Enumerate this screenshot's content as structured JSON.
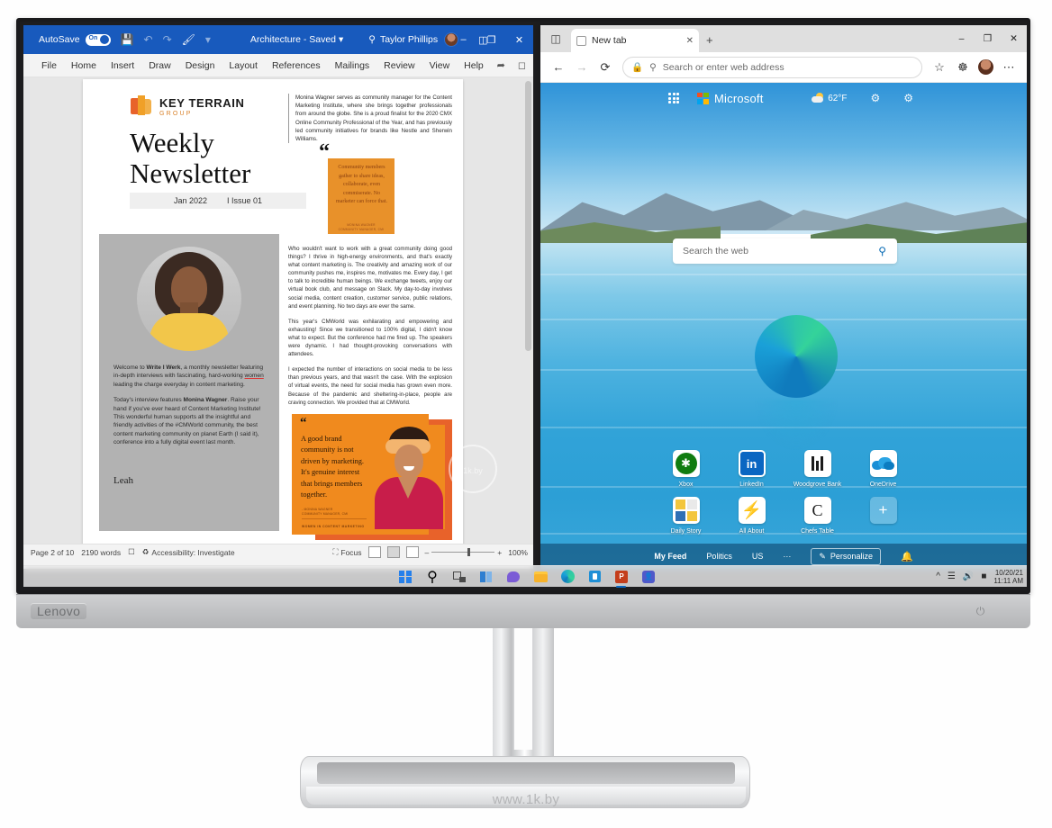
{
  "monitor": {
    "brand": "Lenovo",
    "power_icon": "power-icon",
    "watermark": "www.1k.by"
  },
  "word": {
    "titlebar": {
      "autosave_label": "AutoSave",
      "autosave_state": "On",
      "save_icon": "save-icon",
      "undo_icon": "undo-icon",
      "redo_icon": "redo-icon",
      "draw_icon": "draw-touch-icon",
      "customize_icon": "chevron-down-icon",
      "document_title": "Architecture - Saved",
      "title_dropdown": "▾",
      "search_icon": "search-icon",
      "user_name": "Taylor Phillips",
      "avatar": "user-avatar",
      "ribbon_display_icon": "ribbon-display-options-icon",
      "minimize": "–",
      "maximize": "❐",
      "close": "✕"
    },
    "ribbon_tabs": [
      "File",
      "Home",
      "Insert",
      "Draw",
      "Design",
      "Layout",
      "References",
      "Mailings",
      "Review",
      "View",
      "Help"
    ],
    "ribbon_right": [
      "share-icon",
      "comments-icon"
    ],
    "status": {
      "page_info": "Page 2 of 10",
      "word_count": "2190 words",
      "proofing_icon": "proofing-icon",
      "accessibility_icon": "accessibility-icon",
      "accessibility": "Accessibility: Investigate",
      "focus_icon": "focus-icon",
      "focus": "Focus",
      "view_read_icon": "read-mode-icon",
      "view_print_icon": "print-layout-icon",
      "view_web_icon": "web-layout-icon",
      "zoom_out": "–",
      "zoom_in": "+",
      "zoom_level": "100%"
    },
    "document": {
      "brand_name": "KEY TERRAIN",
      "brand_sub": "GROUP",
      "brand_mark_icon": "key-terrain-logo-icon",
      "title_line1": "Weekly",
      "title_line2": "Newsletter",
      "meta_date": "Jan 2022",
      "meta_issue": "I  Issue 01",
      "portrait_alt": "portrait-monina-wagner",
      "intro_paragraph": "Monina Wagner serves as community manager for the Content Marketing Institute, where she brings together professionals from around the globe. She is a proud finalist for the 2020 CMX Online Community Professional of the Year, and has previously led community initiatives for brands like Nestle and Sherwin Williams.",
      "small_quote": {
        "mark": "“",
        "text": "Community members gather to share ideas, collaborate, even commiserate. No marketer can force that.",
        "attribution_line1": "MONINA WAGNER",
        "attribution_line2": "COMMUNITY MANAGER, CMI"
      },
      "left_col": {
        "p1_a": "Welcome to ",
        "p1_b": "Write I Werk",
        "p1_c": ", a monthly newsletter featuring in-depth interviews with fascinating, hard-working ",
        "p1_d": "women",
        "p1_e": " leading the charge everyday in content marketing.",
        "p2_a": "Today's interview features ",
        "p2_b": "Monina Wagner",
        "p2_c": ". Raise your hand if you've ever heard of Content Marketing Institute! This wonderful human supports all the insightful and friendly activities of the #CMWorld community, the best content marketing community on planet Earth (I said it), conference into a fully digital event last month.",
        "signature": "Leah"
      },
      "body_paragraphs": [
        "Who wouldn't want to work with a great community doing good things? I thrive in high-energy environments, and that's exactly what content marketing is. The creativity and amazing work of our community pushes me, inspires me, motivates me. Every day, I get to talk to incredible human beings. We exchange tweets, enjoy our virtual book club, and message on Slack. My day-to-day involves social media, content creation, customer service, public relations, and event planning. No two days are ever the same.",
        "This year's CMWorld was exhilarating and empowering and exhausting! Since we transitioned to 100% digital, I didn't know what to expect. But the conference had me fired up. The speakers were dynamic. I had thought-provoking conversations with attendees.",
        "I expected the number of interactions on social media to be less than previous years, and that wasn't the case. With the explosion of virtual events, the need for social media has grown even more. Because of the pandemic and sheltering-in-place, people are craving connection. We provided that at CMWorld."
      ],
      "big_quote": {
        "mark": "“",
        "text": "A good brand community is not driven by marketing. It's genuine interest that brings members together.",
        "attribution_line1": "- MONINA WAGNER",
        "attribution_line2": "COMMUNITY MANAGER, CMI",
        "footer": "WOMEN IN CONTENT MARKETING",
        "photo_alt": "portrait-quote-person"
      },
      "watermark": "1k.by"
    }
  },
  "edge": {
    "tab_profile_icon": "tab-actions-icon",
    "tab": {
      "favicon": "tab-favicon",
      "title": "New tab",
      "close": "✕"
    },
    "new_tab_btn": "+",
    "window": {
      "minimize": "–",
      "maximize": "❐",
      "close": "✕"
    },
    "toolbar": {
      "back": "back-arrow-icon",
      "forward": "forward-arrow-icon",
      "refresh": "refresh-icon",
      "lock_icon": "site-info-icon",
      "search_icon": "search-icon",
      "address_placeholder": "Search or enter web address",
      "favorite_icon": "add-favorite-icon",
      "collections_icon": "collections-icon",
      "profile_icon": "profile-avatar",
      "more_icon": "more-options-icon"
    },
    "newtab": {
      "waffle_icon": "app-launcher-icon",
      "ms_logo_icon": "microsoft-logo-icon",
      "ms_word": "Microsoft",
      "weather_icon": "partly-sunny-icon",
      "weather_temp": "62°F",
      "rewards_icon": "settings-gear-icon",
      "settings_icon": "page-settings-gear-icon",
      "search_placeholder": "Search the web",
      "search_submit_icon": "search-submit-icon",
      "hero_icon": "edge-logo-hero",
      "tiles": [
        {
          "label": "Xbox",
          "icon": "xbox-icon"
        },
        {
          "label": "LinkedIn",
          "icon": "linkedin-icon"
        },
        {
          "label": "Woodgrove Bank",
          "icon": "woodgrove-bank-icon"
        },
        {
          "label": "OneDrive",
          "icon": "onedrive-icon"
        },
        {
          "label": "Daily Story",
          "icon": "daily-story-icon"
        },
        {
          "label": "All About",
          "icon": "all-about-icon"
        },
        {
          "label": "Chefs Table",
          "icon": "chefs-table-icon"
        },
        {
          "label": "",
          "icon": "add-site-icon"
        }
      ],
      "feed_tabs": [
        "My Feed",
        "Politics",
        "US",
        "···"
      ],
      "personalize_icon": "pencil-icon",
      "personalize_label": "Personalize",
      "notifications_icon": "bell-icon"
    }
  },
  "taskbar": {
    "items": [
      {
        "name": "start-button",
        "icon": "windows-logo-icon"
      },
      {
        "name": "search-button",
        "icon": "search-icon"
      },
      {
        "name": "task-view-button",
        "icon": "task-view-icon"
      },
      {
        "name": "widgets-button",
        "icon": "widgets-icon"
      },
      {
        "name": "chat-button",
        "icon": "chat-icon"
      },
      {
        "name": "file-explorer-button",
        "icon": "folder-icon"
      },
      {
        "name": "edge-button",
        "icon": "edge-icon"
      },
      {
        "name": "store-button",
        "icon": "store-icon"
      },
      {
        "name": "powerpoint-button",
        "icon": "powerpoint-icon",
        "label": "P"
      },
      {
        "name": "teams-button",
        "icon": "teams-icon",
        "label": "‣"
      }
    ],
    "tray": {
      "chevron": "show-hidden-icons",
      "network_icon": "wifi-icon",
      "volume_icon": "volume-icon",
      "battery_icon": "battery-icon",
      "date": "10/20/21",
      "time": "11:11 AM"
    }
  }
}
